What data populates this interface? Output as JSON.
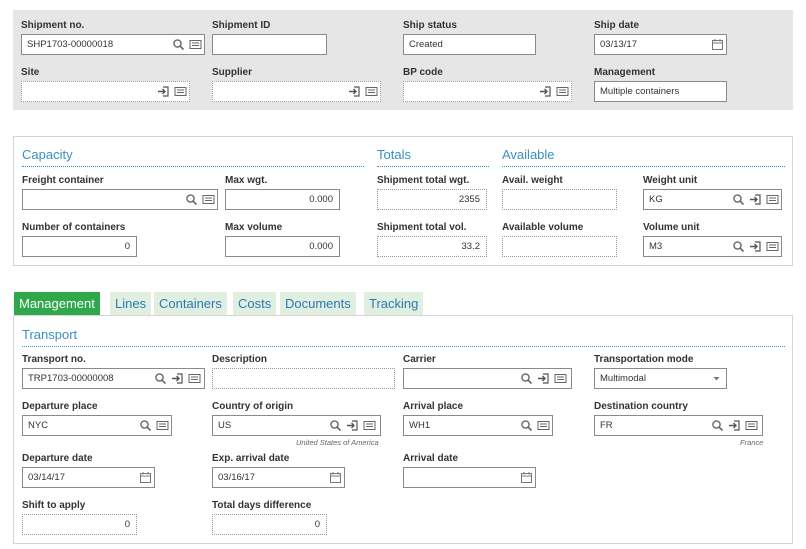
{
  "header": {
    "shipment_no_label": "Shipment no.",
    "shipment_no": "SHP1703-00000018",
    "shipment_id_label": "Shipment ID",
    "shipment_id": "",
    "ship_status_label": "Ship status",
    "ship_status": "Created",
    "ship_date_label": "Ship date",
    "ship_date": "03/13/17",
    "site_label": "Site",
    "site": "",
    "supplier_label": "Supplier",
    "supplier": "",
    "bp_code_label": "BP code",
    "bp_code": "",
    "management_label": "Management",
    "management": "Multiple containers"
  },
  "capacity": {
    "title": "Capacity",
    "freight_container_label": "Freight container",
    "freight_container": "",
    "max_wgt_label": "Max wgt.",
    "max_wgt": "0.000",
    "num_containers_label": "Number of containers",
    "num_containers": "0",
    "max_volume_label": "Max volume",
    "max_volume": "0.000"
  },
  "totals": {
    "title": "Totals",
    "total_wgt_label": "Shipment total wgt.",
    "total_wgt": "2355",
    "total_vol_label": "Shipment total vol.",
    "total_vol": "33.2"
  },
  "available": {
    "title": "Available",
    "avail_weight_label": "Avail. weight",
    "avail_weight": "",
    "weight_unit_label": "Weight unit",
    "weight_unit": "KG",
    "available_volume_label": "Available volume",
    "available_volume": "",
    "volume_unit_label": "Volume unit",
    "volume_unit": "M3"
  },
  "tabs": [
    "Management",
    "Lines",
    "Containers",
    "Costs",
    "Documents",
    "Tracking"
  ],
  "transport": {
    "title": "Transport",
    "transport_no_label": "Transport no.",
    "transport_no": "TRP1703-00000008",
    "description_label": "Description",
    "description": "",
    "carrier_label": "Carrier",
    "carrier": "",
    "mode_label": "Transportation mode",
    "mode": "Multimodal",
    "departure_place_label": "Departure place",
    "departure_place": "NYC",
    "country_origin_label": "Country of origin",
    "country_origin": "US",
    "country_origin_name": "United States of America",
    "arrival_place_label": "Arrival place",
    "arrival_place": "WH1",
    "destination_country_label": "Destination country",
    "destination_country": "FR",
    "destination_country_name": "France",
    "departure_date_label": "Departure date",
    "departure_date": "03/14/17",
    "exp_arrival_label": "Exp. arrival date",
    "exp_arrival": "03/16/17",
    "arrival_date_label": "Arrival date",
    "arrival_date": "",
    "shift_label": "Shift to apply",
    "shift": "0",
    "total_days_label": "Total days difference",
    "total_days": "0"
  },
  "colors": {
    "accent": "#3a8fc4",
    "active_tab": "#2ea84a",
    "tab_bg": "#e0efe0",
    "header_bg": "#e6e6e6"
  }
}
